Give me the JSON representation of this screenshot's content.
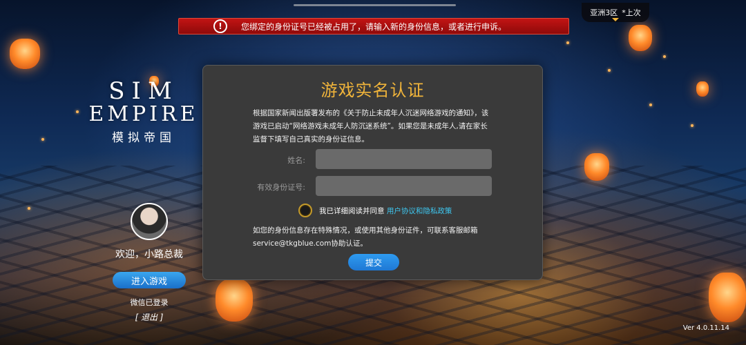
{
  "banner": {
    "warning_icon": "!",
    "message": "您绑定的身份证号已经被占用了，请输入新的身份信息，或者进行申诉。"
  },
  "server": {
    "name": "亚洲3区",
    "tag": "*上次"
  },
  "logo": {
    "line1": "SIM",
    "line2": "EMPIRE",
    "line3": "模拟帝国"
  },
  "account": {
    "welcome": "欢迎，小路总裁",
    "enter_button": "进入游戏",
    "wechat_status": "微信已登录",
    "logout": "[ 退出 ]"
  },
  "dialog": {
    "title": "游戏实名认证",
    "description": "根据国家新闻出版署发布的《关于防止未成年人沉迷网络游戏的通知》，该游戏已启动“网络游戏未成年人防沉迷系统”。如果您是未成年人,请在家长监督下填写自己真实的身份证信息。",
    "name_label": "姓名:",
    "name_value": "",
    "id_label": "有效身份证号:",
    "id_value": "",
    "agree_text": "我已详细阅读并同意",
    "agree_link": "用户协议和隐私政策",
    "note": "如您的身份信息存在特殊情况，或使用其他身份证件，可联系客服邮箱service@tkgblue.com协助认证。",
    "submit": "提交"
  },
  "version": "Ver 4.0.11.14"
}
